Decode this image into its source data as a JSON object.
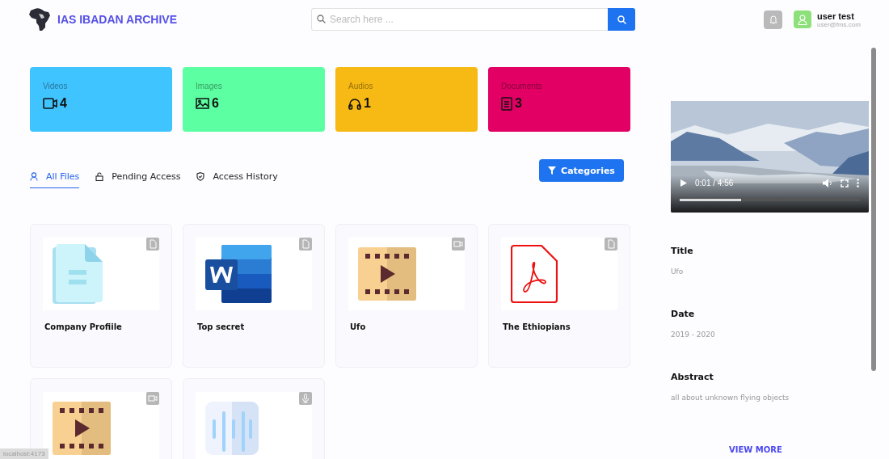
{
  "header": {
    "title": "IAS IBADAN ARCHIVE",
    "search": {
      "placeholder": "Search here ..."
    },
    "user": {
      "name": "user test",
      "email": "user@fms.com"
    }
  },
  "stats": [
    {
      "label": "Videos",
      "count": "4",
      "color": "#40c4ff"
    },
    {
      "label": "Images",
      "count": "6",
      "color": "#5dffa3"
    },
    {
      "label": "Audios",
      "count": "1",
      "color": "#f7b913"
    },
    {
      "label": "Documents",
      "count": "3",
      "color": "#e20064"
    }
  ],
  "tabs": [
    {
      "label": "All Files",
      "selected": true
    },
    {
      "label": "Pending Access",
      "selected": false
    },
    {
      "label": "Access History",
      "selected": false
    }
  ],
  "categories_button": "Categories",
  "files": [
    {
      "name": "Company Profiile",
      "kind": "document"
    },
    {
      "name": "Top secret",
      "kind": "word"
    },
    {
      "name": "Ufo",
      "kind": "video"
    },
    {
      "name": "The Ethiopians",
      "kind": "pdf"
    },
    {
      "kind": "video"
    },
    {
      "kind": "audio"
    }
  ],
  "player": {
    "time": "0:01 / 4:56",
    "level": 0.34
  },
  "details": [
    {
      "label": "Title",
      "value": "Ufo"
    },
    {
      "label": "Date",
      "value": "2019 - 2020"
    },
    {
      "label": "Abstract",
      "value": "all about unknown flying objects"
    }
  ],
  "view_more": "VIEW MORE",
  "status_bar": "localhost:4173"
}
